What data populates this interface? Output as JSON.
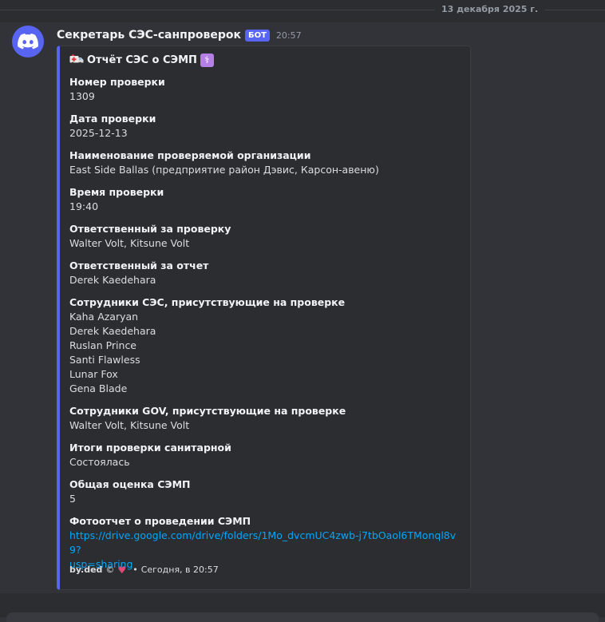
{
  "date_divider": "13 декабря 2025 г.",
  "message": {
    "author": "Секретарь СЭС-санпроверок",
    "bot_tag": "БОТ",
    "timestamp": "20:57",
    "avatar_icon": "discord-logo-icon"
  },
  "embed": {
    "accent_color": "#5865f2",
    "title_icon": "ambulance-icon",
    "title": "Отчёт СЭС о СЭМП",
    "title_badge_icon": "medical-symbol-icon",
    "fields": [
      {
        "name": "Номер проверки",
        "value": "1309"
      },
      {
        "name": "Дата проверки",
        "value": "2025-12-13"
      },
      {
        "name": "Наименование проверяемой организации",
        "value": "East Side Ballas (предприятие район Дэвис, Карсон-авеню)"
      },
      {
        "name": "Время проверки",
        "value": "19:40"
      },
      {
        "name": "Ответственный за проверку",
        "value": "Walter Volt, Kitsune Volt"
      },
      {
        "name": "Ответственный за отчет",
        "value": "Derek Kaedehara"
      },
      {
        "name": "Сотрудники СЭС, присутствующие на проверке",
        "values": [
          "Kaha Azaryan",
          "Derek Kaedehara",
          "Ruslan Prince",
          "Santi Flawless",
          "Lunar Fox",
          "Gena Blade"
        ]
      },
      {
        "name": "Сотрудники GOV, присутствующие на проверке",
        "value": "Walter Volt, Kitsune Volt"
      },
      {
        "name": "Итоги проверки санитарной",
        "value": "Состоялась"
      },
      {
        "name": "Общая оценка СЭМП",
        "value": "5"
      },
      {
        "name": "Фотоотчет о проведении СЭМП",
        "link_line1": "https://drive.google.com/drive/folders/1Mo_dvcmUC4zwb-j7tbOaol6TMonql8v9?",
        "link_line2": "usp=sharing"
      }
    ],
    "footer": {
      "text": "by.ded",
      "copyright": "©",
      "heart_icon": "heart-icon",
      "separator": "•",
      "time": "Сегодня, в 20:57"
    }
  }
}
